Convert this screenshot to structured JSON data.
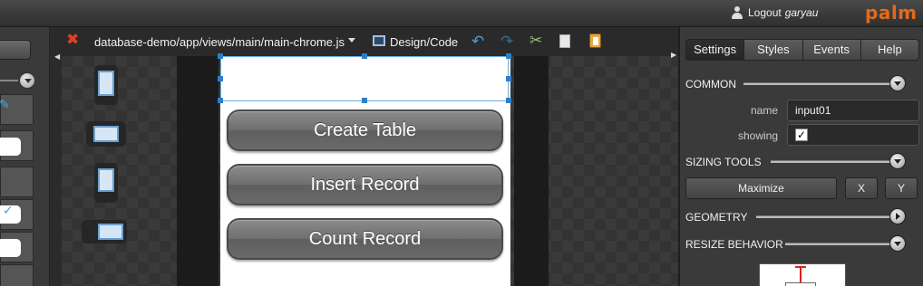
{
  "header": {
    "logout_label": "Logout",
    "username": "garyau",
    "brand": "palm"
  },
  "toolbar": {
    "file_path": "database-demo/app/views/main/main-chrome.js",
    "view_mode_label": "Design/Code"
  },
  "app": {
    "buttons": [
      {
        "label": "Create Table"
      },
      {
        "label": "Insert Record"
      },
      {
        "label": "Count Record"
      }
    ]
  },
  "inspector": {
    "tabs": [
      "Settings",
      "Styles",
      "Events",
      "Help"
    ],
    "sections": {
      "common": "COMMON",
      "sizing_tools": "SIZING TOOLS",
      "geometry": "GEOMETRY",
      "resize_behavior": "RESIZE BEHAVIOR"
    },
    "properties": {
      "name_label": "name",
      "name_value": "input01",
      "showing_label": "showing",
      "showing_checked": true
    },
    "sizing": {
      "maximize": "Maximize",
      "x": "X",
      "y": "Y"
    }
  },
  "icons": {
    "close": "close-icon",
    "undo": "undo-icon",
    "redo": "redo-icon",
    "cut": "cut-icon",
    "copy": "copy-icon",
    "paste": "paste-icon"
  },
  "colors": {
    "brand": "#e06a1e",
    "selection": "#2f7fc8",
    "close": "#e0402a"
  }
}
